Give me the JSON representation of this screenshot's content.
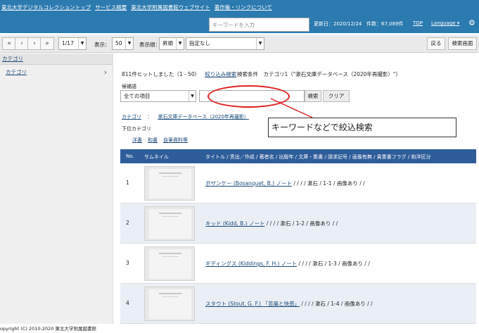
{
  "topnav": {
    "links": [
      "東北大学デジタルコレクショントップ",
      "サービス概要",
      "東北大学附属図書館ウェブサイト",
      "著作権・リンクについて"
    ]
  },
  "subnav": {
    "search_placeholder": "キーワードを入力",
    "updated": "更新日：2020/12/24",
    "count": "件数：67,089件",
    "top_link": "TOP",
    "language": "Language ▾",
    "gear_icon": "gear-icon"
  },
  "toolbar": {
    "first": "«",
    "prev": "‹",
    "next": "›",
    "last": "»",
    "page_select": "1/17",
    "display_label": "表示：",
    "display_value": "50",
    "order_label": "表示順：",
    "order_value": "昇順",
    "sort_value": "指定なし",
    "back": "戻る",
    "search_screen": "検索画面"
  },
  "sidebar": {
    "heading": "カテゴリ",
    "items": [
      {
        "label": "カテゴリ"
      }
    ]
  },
  "main": {
    "hits": "811件ヒットしました（1 - 50）",
    "narrow_link": "絞り込み検索",
    "conditions": "検索条件　カテゴリ1（\"漱石文庫データベース（2020年再撮影）\"）",
    "candidate_label": "候補語",
    "candidate_select": "全ての項目",
    "search_btn": "検索",
    "clear_btn": "クリア",
    "annotation": "キーワードなどで絞込検索",
    "crumb_label": "カテゴリ",
    "crumb_sep": "：",
    "crumb_value": "漱石文庫データベース（2020年再撮影）",
    "subcat_label": "下位カテゴリ",
    "subcats": [
      "洋書",
      "和書",
      "自筆資料等"
    ]
  },
  "table": {
    "headers": {
      "no": "No.",
      "thumb": "サムネイル",
      "info": "タイトル / 责出／作成 / 著者名 / 出版年 / 文庫・集書 / 請求記号 / 画像有無 / 貴重書フラグ / 和洋区分"
    },
    "rows": [
      {
        "no": "1",
        "title": "ボザンケー (Bosanquet, B.) ノート",
        "rest": " / / / / 漱石 / 1-1 / 画像あり / /"
      },
      {
        "no": "2",
        "title": "キッド (Kidd, B.) ノート",
        "rest": " / / / / 漱石 / 1-2 / 画像あり / /"
      },
      {
        "no": "3",
        "title": "ギディングス (Kiddings, F. H.) ノート",
        "rest": " / / / / 漱石 / 1-3 / 画像あり / /"
      },
      {
        "no": "4",
        "title": "スタウト (Stout, G. F.) 「苦痛と快感」",
        "rest": " / / / / 漱石 / 1-4 / 画像あり / /"
      }
    ]
  },
  "footer": {
    "text": "opyright (C) 2010-2020 東北大学附属図書館"
  }
}
